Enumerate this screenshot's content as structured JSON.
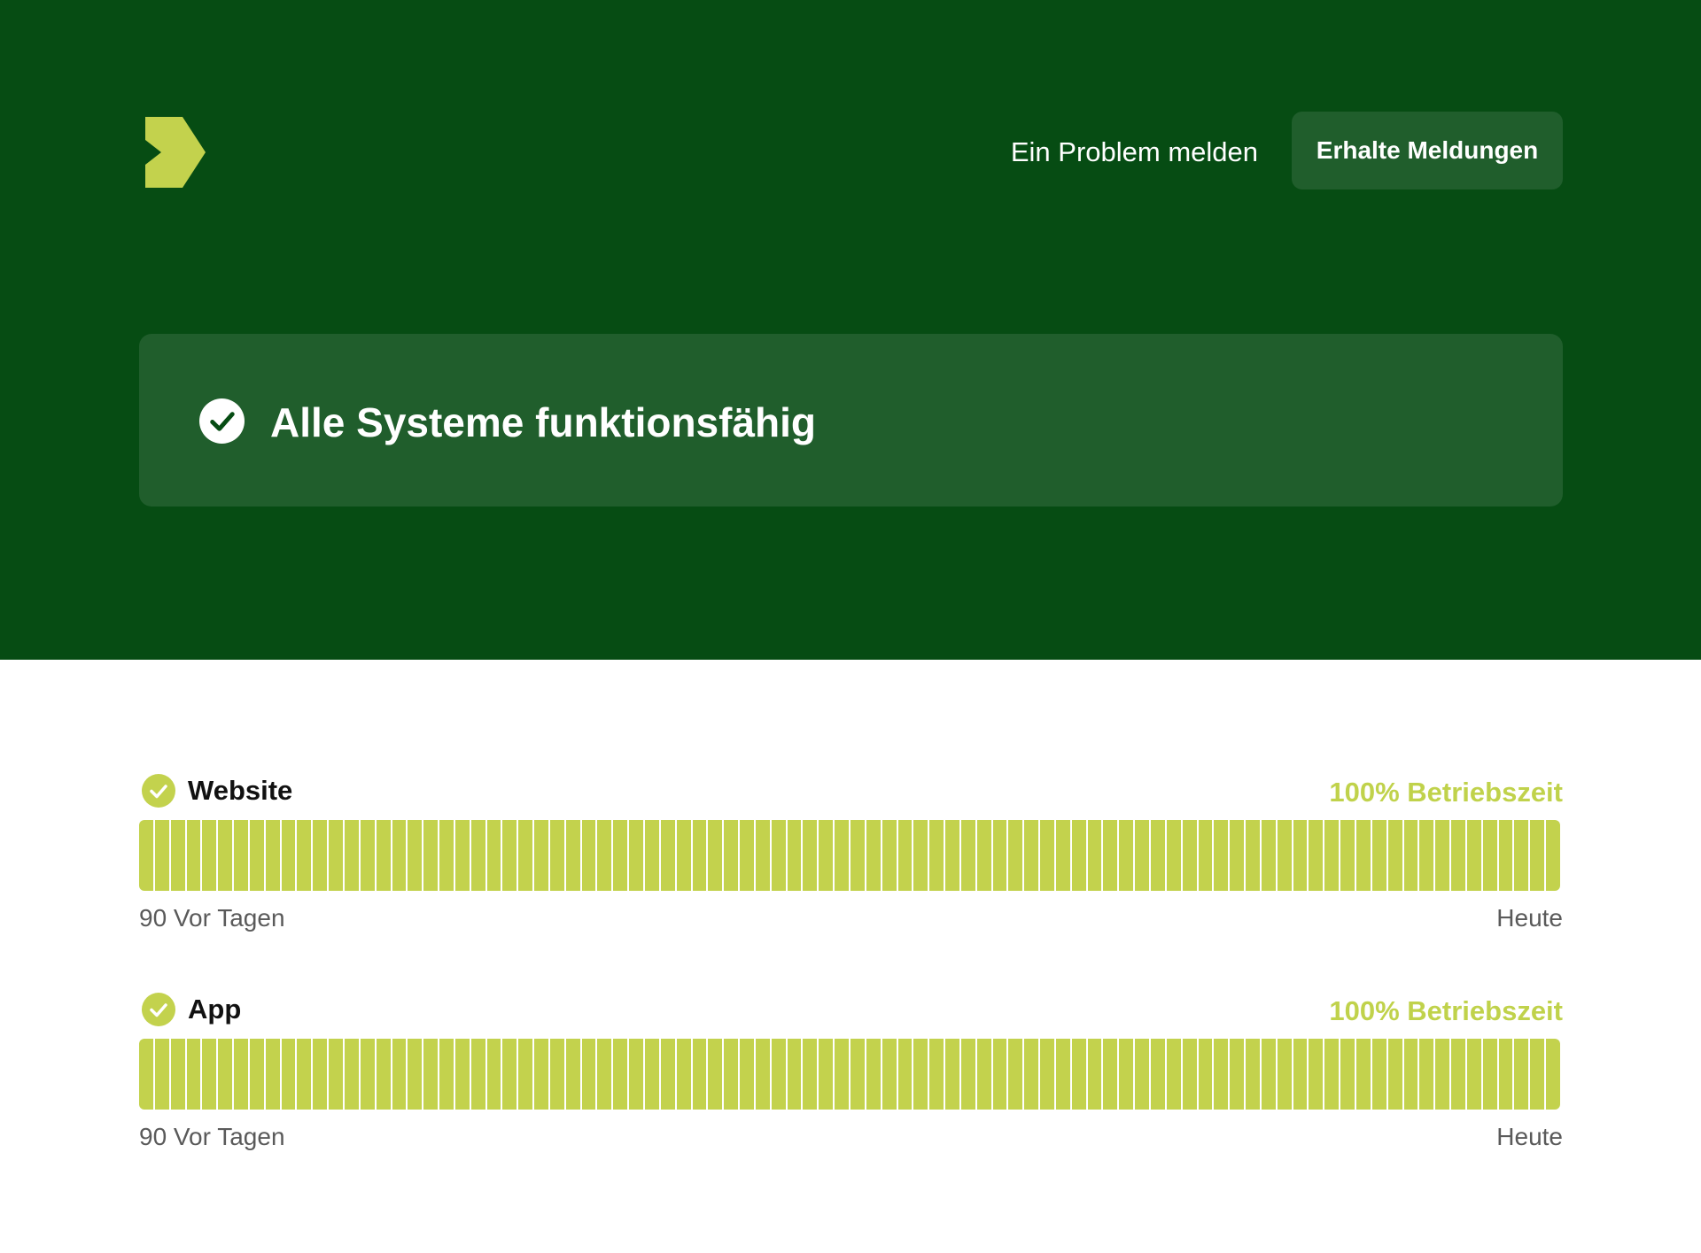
{
  "header": {
    "logo_icon": "chevron-right-logo",
    "report_link": "Ein Problem melden",
    "subscribe_button": "Erhalte Meldungen"
  },
  "status": {
    "icon": "check-circle-icon",
    "text": "Alle Systeme funktionsfähig"
  },
  "components": [
    {
      "name": "Website",
      "uptime": "100% Betriebszeit",
      "range_start": "90 Vor Tagen",
      "range_end": "Heute",
      "days_up": 90
    },
    {
      "name": "App",
      "uptime": "100% Betriebszeit",
      "range_start": "90 Vor Tagen",
      "range_end": "Heute",
      "days_up": 90
    }
  ],
  "colors": {
    "hero_background": "#064c13",
    "banner_background": "#205e2c",
    "accent": "#c3d24d",
    "uptime_text": "#c0d24b"
  }
}
